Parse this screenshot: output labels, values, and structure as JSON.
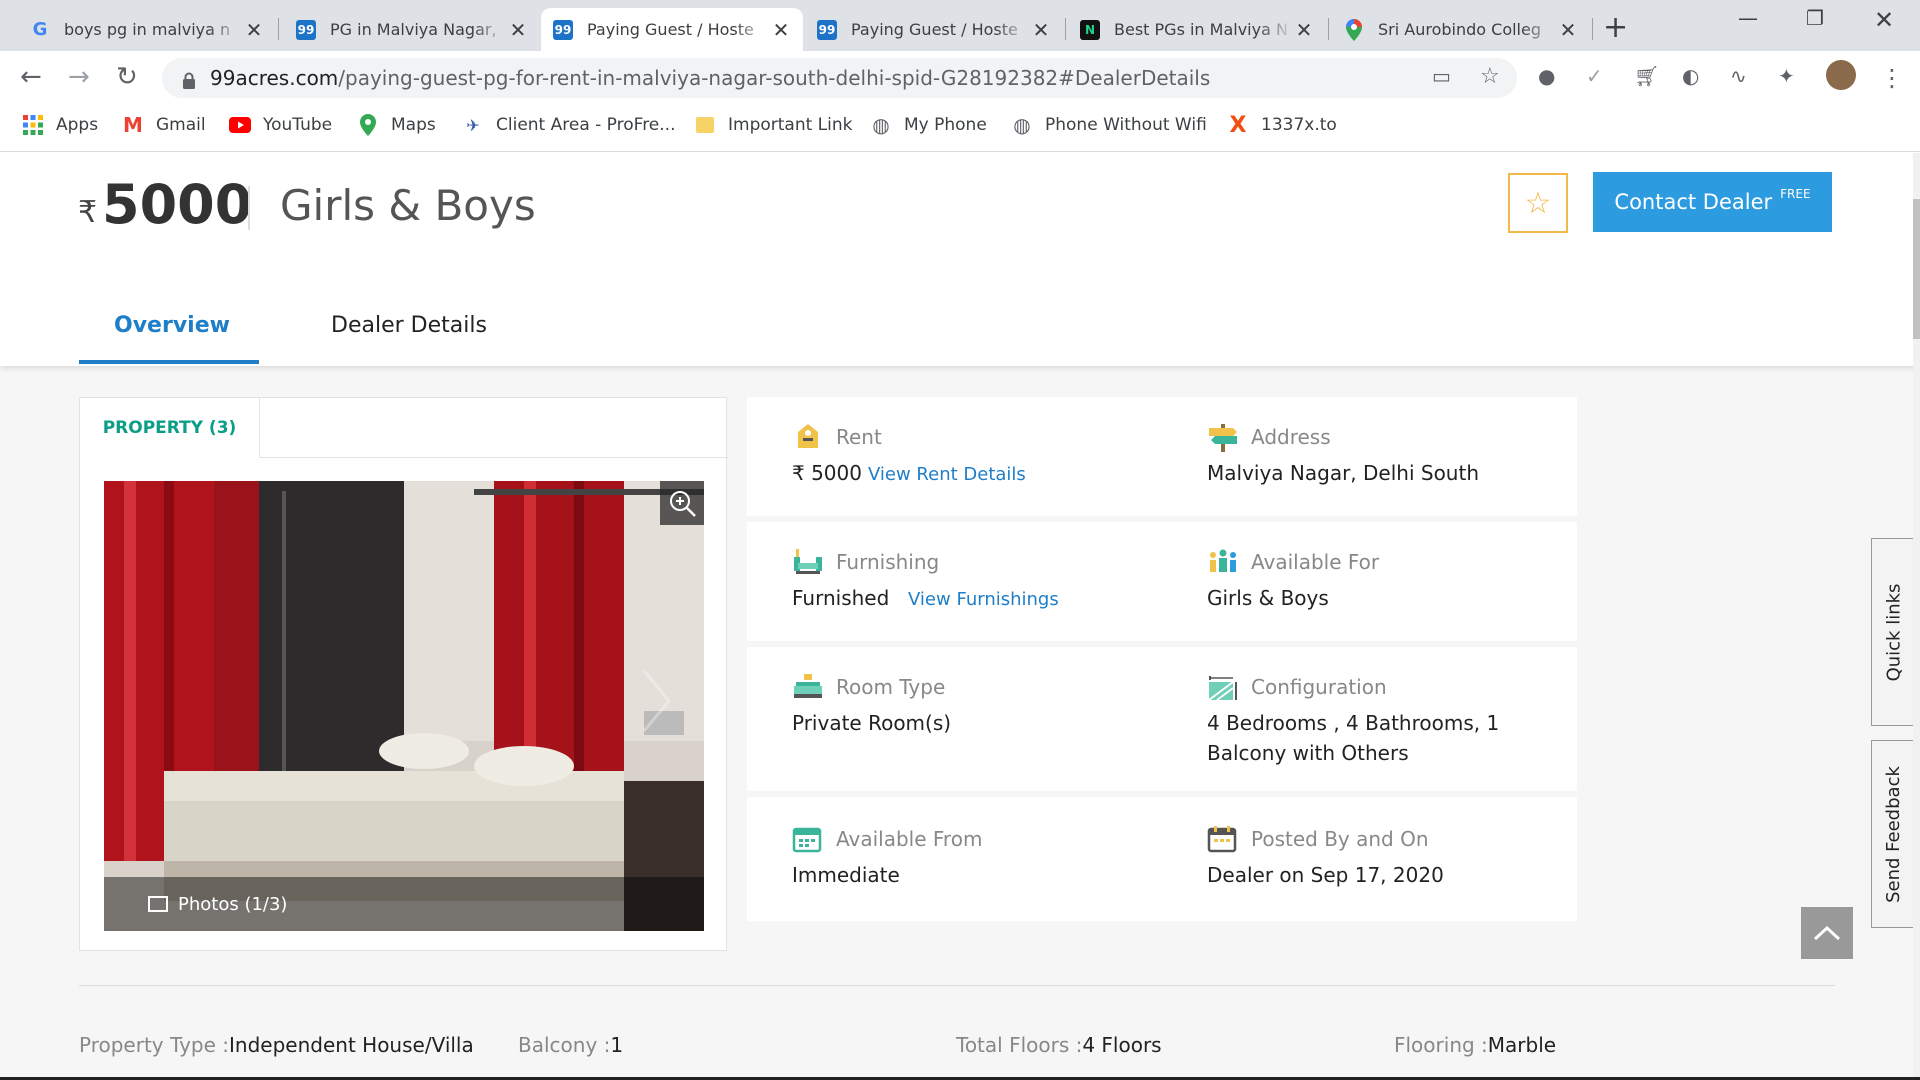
{
  "browser": {
    "tabs": [
      {
        "title": "boys pg in malviya n",
        "favicon": "G"
      },
      {
        "title": "PG in Malviya Nagar,",
        "favicon": "99"
      },
      {
        "title": "Paying Guest / Hoste",
        "favicon": "99"
      },
      {
        "title": "Paying Guest / Hoste",
        "favicon": "99"
      },
      {
        "title": "Best PGs in Malviya N",
        "favicon": "N"
      },
      {
        "title": "Sri Aurobindo Colleg",
        "favicon": "maps-pin"
      }
    ],
    "url_domain": "99acres.com",
    "url_path": "/paying-guest-pg-for-rent-in-malviya-nagar-south-delhi-spid-G28192382#DealerDetails",
    "bookmarks": [
      {
        "label": "Apps"
      },
      {
        "label": "Gmail"
      },
      {
        "label": "YouTube"
      },
      {
        "label": "Maps"
      },
      {
        "label": "Client Area - ProFre..."
      },
      {
        "label": "Important Link"
      },
      {
        "label": "My Phone"
      },
      {
        "label": "Phone Without Wifi"
      },
      {
        "label": "1337x.to"
      }
    ]
  },
  "header": {
    "currency": "₹",
    "price": "5000",
    "available_for": "Girls & Boys",
    "contact_label": "Contact Dealer",
    "contact_badge": "FREE"
  },
  "tabs": {
    "overview": "Overview",
    "dealer": "Dealer Details"
  },
  "property_card": {
    "tab_label": "PROPERTY (3)",
    "photos_label": "Photos (1/3)"
  },
  "details": {
    "rent_label": "Rent",
    "rent_value": "₹ 5000",
    "rent_link": "View Rent Details",
    "address_label": "Address",
    "address_value": "Malviya Nagar, Delhi South",
    "furnishing_label": "Furnishing",
    "furnishing_value": "Furnished",
    "furnishing_link": "View Furnishings",
    "available_for_label": "Available For",
    "available_for_value": "Girls & Boys",
    "room_type_label": "Room Type",
    "room_type_value": "Private Room(s)",
    "configuration_label": "Configuration",
    "configuration_value_1": "4 Bedrooms , 4 Bathrooms, 1",
    "configuration_value_2": "Balcony with Others",
    "available_from_label": "Available From",
    "available_from_value": "Immediate",
    "posted_label": "Posted By and On",
    "posted_value": "Dealer on Sep 17, 2020"
  },
  "specs": {
    "property_type_label": "Property Type :",
    "property_type_value": "Independent House/Villa",
    "balcony_label": "Balcony :",
    "balcony_value": "1",
    "total_floors_label": "Total Floors :",
    "total_floors_value": "4 Floors",
    "flooring_label": "Flooring :",
    "flooring_value": "Marble"
  },
  "side": {
    "quick_links": "Quick links",
    "send_feedback": "Send Feedback"
  },
  "colors": {
    "accent_blue": "#2d9be0",
    "link_blue": "#1e7ec8",
    "teal": "#0a9e87",
    "star_gold": "#f0b94a"
  }
}
